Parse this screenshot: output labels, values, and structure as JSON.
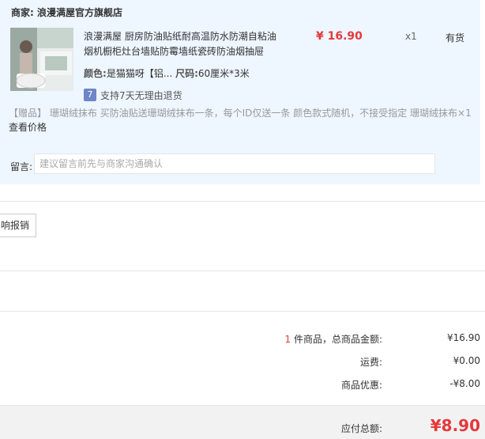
{
  "store": {
    "label": "商家:",
    "name": "浪漫满屋官方旗舰店"
  },
  "item": {
    "title": "浪漫满屋 厨房防油贴纸耐高温防水防潮自粘油烟机橱柜灶台墙贴防霉墙纸瓷砖防油烟抽屉",
    "price": "¥ 16.90",
    "qty": "x1",
    "stock": "有货",
    "color_label": "颜色:",
    "color_value": "是猫猫呀【铝...",
    "size_label": "尺码:",
    "size_value": "60厘米*3米",
    "refund_icon": "7",
    "refund_text": "支持7天无理由退货"
  },
  "gift": {
    "text": "【赠品】 珊瑚绒抹布 买防油贴送珊瑚绒抹布一条，每个ID仅送一条 颜色款式随机，不接受指定 珊瑚绒抹布×1",
    "view": "查看价格"
  },
  "memo": {
    "label": "留言:",
    "placeholder": "建议留言前先与商家沟通确认"
  },
  "invoice": {
    "label": "响报销"
  },
  "summary": {
    "count": "1",
    "count_suffix": " 件商品，总商品金额:",
    "total": "¥16.90",
    "shipping_label": "运费:",
    "shipping": "¥0.00",
    "discount_label": "商品优惠:",
    "discount": "-¥8.00",
    "pay_label": "应付总额:",
    "pay": "¥8.90"
  },
  "colors": {
    "panel": "#eef6ff",
    "accent": "#e4393c"
  },
  "icons": {
    "refund": "refund-badge-icon",
    "product": "product-thumbnail"
  }
}
